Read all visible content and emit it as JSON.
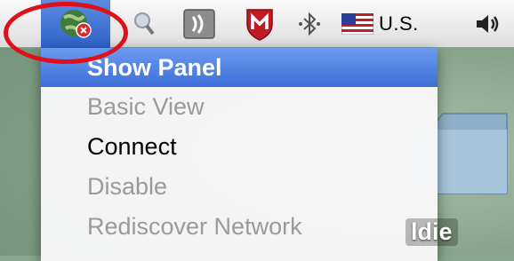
{
  "menubar": {
    "language_label": "U.S."
  },
  "menu": {
    "items": [
      {
        "label": "Show Panel",
        "state": "selected"
      },
      {
        "label": "Basic View",
        "state": "disabled"
      },
      {
        "label": "Connect",
        "state": "enabled"
      },
      {
        "label": "Disable",
        "state": "disabled"
      },
      {
        "label": "Rediscover Network",
        "state": "disabled"
      }
    ]
  },
  "desktop": {
    "folder_label": "ldie"
  },
  "colors": {
    "highlight_ring": "#e0101a",
    "menu_selection": "#3d6fd8"
  }
}
